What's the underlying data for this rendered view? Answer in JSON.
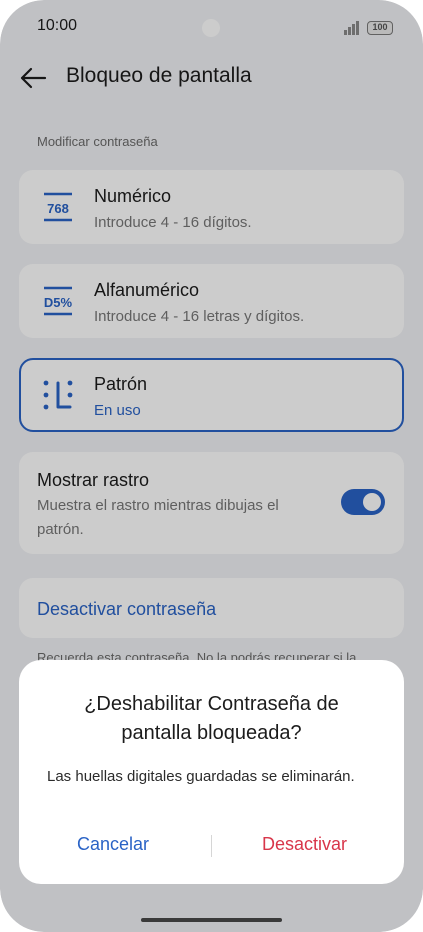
{
  "status_bar": {
    "time": "10:00",
    "battery": "100"
  },
  "header": {
    "title": "Bloqueo de pantalla"
  },
  "section": {
    "label": "Modificar contraseña"
  },
  "options": [
    {
      "icon_text": "768",
      "title": "Numérico",
      "subtitle": "Introduce 4 - 16 dígitos."
    },
    {
      "icon_text": "D5%",
      "title": "Alfanumérico",
      "subtitle": "Introduce 4 - 16 letras y dígitos."
    },
    {
      "title": "Patrón",
      "subtitle": "En uso",
      "selected": true
    }
  ],
  "show_trace": {
    "title": "Mostrar rastro",
    "description": "Muestra el rastro mientras dibujas el patrón.",
    "enabled": true
  },
  "deactivate": {
    "label": "Desactivar contraseña"
  },
  "note": {
    "text": "Recuerda esta contraseña. No la podrás recuperar si la"
  },
  "dialog": {
    "title": "¿Deshabilitar Contraseña de pantalla bloqueada?",
    "body": "Las huellas digitales guardadas se eliminarán.",
    "cancel_label": "Cancelar",
    "confirm_label": "Desactivar"
  },
  "colors": {
    "accent": "#2a63c6",
    "danger": "#d8364a",
    "background": "#f1f2f5"
  }
}
